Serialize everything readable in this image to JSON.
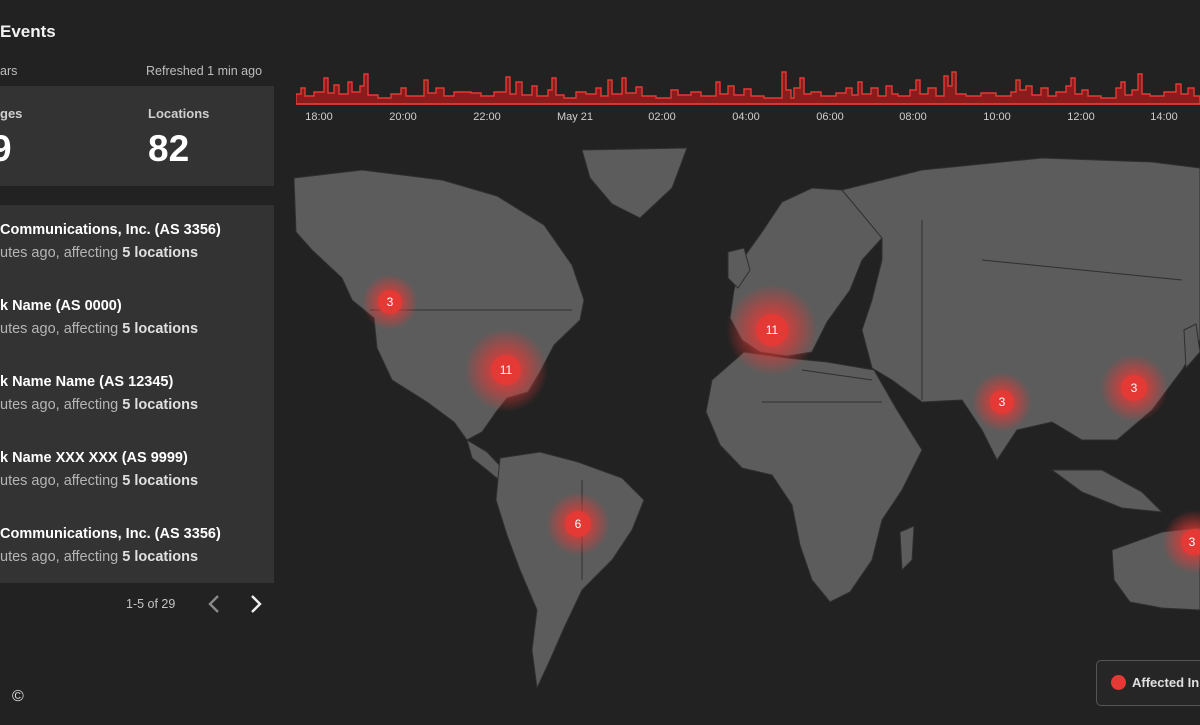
{
  "header": {
    "title": "Events",
    "range": "ars",
    "refreshed": "Refreshed 1 min ago"
  },
  "stats": {
    "outages_label": "ges",
    "outages_value": "9",
    "locations_label": "Locations",
    "locations_value": "82"
  },
  "events": [
    {
      "title": "Communications, Inc. (AS 3356)",
      "time": "utes ago",
      "mid": ", affecting ",
      "affected": "5 locations"
    },
    {
      "title": "k Name (AS 0000)",
      "time": "utes ago",
      "mid": ", affecting ",
      "affected": "5 locations"
    },
    {
      "title": "k Name Name (AS 12345)",
      "time": "utes ago",
      "mid": ", affecting ",
      "affected": "5 locations"
    },
    {
      "title": "k Name XXX XXX (AS 9999)",
      "time": "utes ago",
      "mid": ", affecting ",
      "affected": "5 locations"
    },
    {
      "title": "Communications, Inc. (AS 3356)",
      "time": "utes ago",
      "mid": ", affecting ",
      "affected": "5 locations"
    }
  ],
  "pagination": {
    "text": "1-5 of 29",
    "prev_icon": "chevron-left-icon",
    "next_icon": "chevron-right-icon"
  },
  "timeline": {
    "ticks": [
      "18:00",
      "20:00",
      "22:00",
      "May 21",
      "02:00",
      "04:00",
      "06:00",
      "08:00",
      "10:00",
      "12:00",
      "14:00"
    ]
  },
  "map": {
    "markers": [
      {
        "label": "3",
        "region": "US West"
      },
      {
        "label": "11",
        "region": "US East"
      },
      {
        "label": "11",
        "region": "Western Europe"
      },
      {
        "label": "3",
        "region": "India"
      },
      {
        "label": "3",
        "region": "East Asia"
      },
      {
        "label": "6",
        "region": "Brazil"
      },
      {
        "label": "3",
        "region": "Australia"
      }
    ]
  },
  "legend": {
    "label": "Affected In"
  },
  "footer": {
    "copyright": "©"
  },
  "colors": {
    "accent": "#e53935",
    "background": "#222222",
    "panel": "#333333",
    "land": "#5c5c5c"
  }
}
